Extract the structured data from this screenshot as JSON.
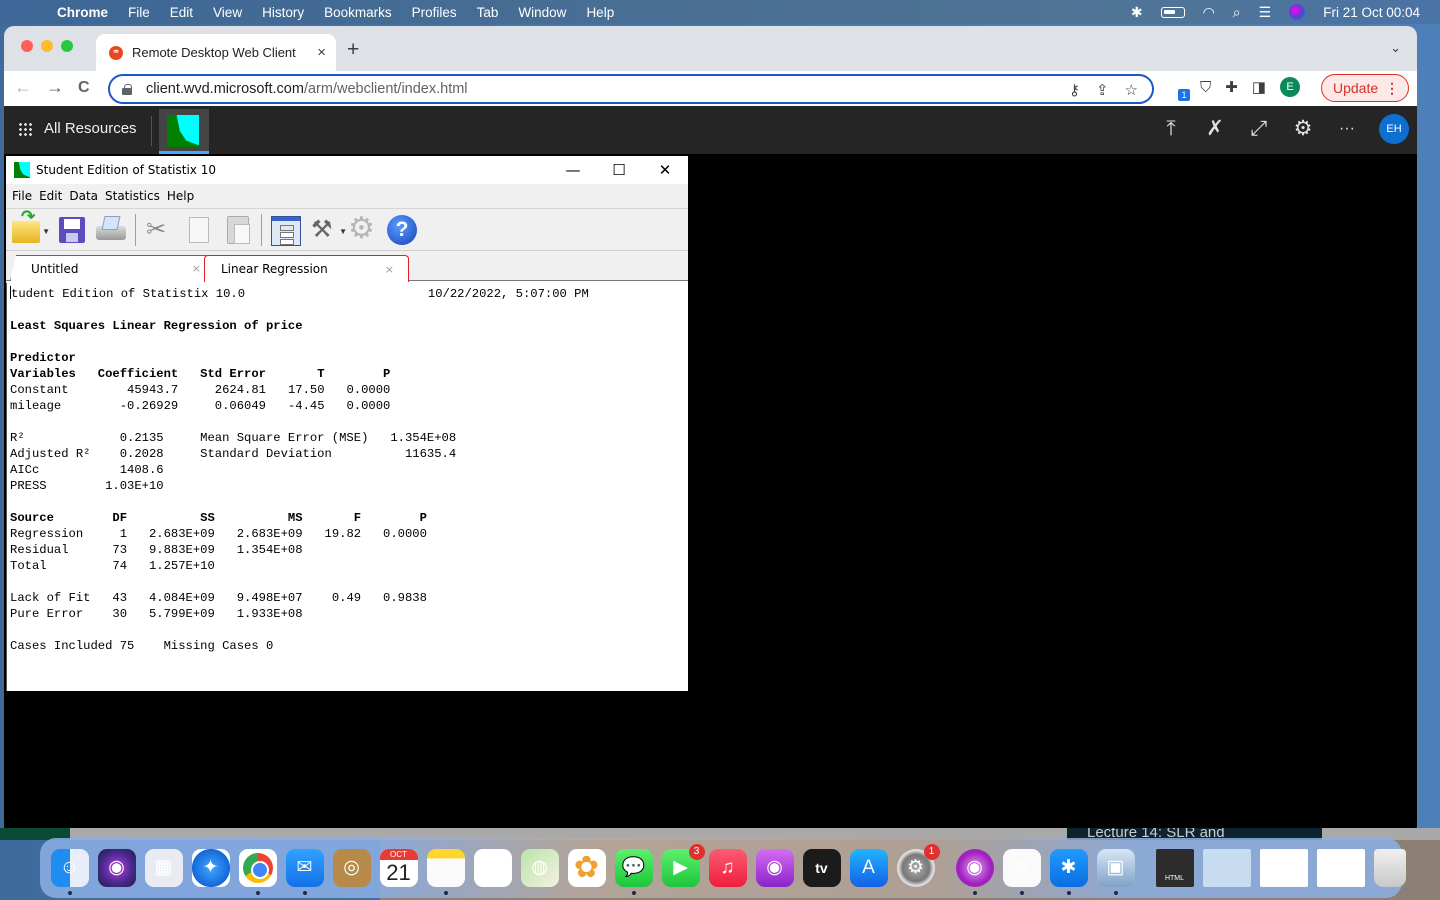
{
  "menubar": {
    "apple_icon": "apple-logo-icon",
    "app_name": "Chrome",
    "items": [
      "File",
      "Edit",
      "View",
      "History",
      "Bookmarks",
      "Profiles",
      "Tab",
      "Window",
      "Help"
    ],
    "status_icons": [
      "bluetooth-icon",
      "battery-icon",
      "wifi-icon",
      "spotlight-search-icon",
      "control-center-icon",
      "siri-icon"
    ],
    "clock": "Fri 21 Oct  00:04"
  },
  "browser": {
    "tab": {
      "title": "Remote Desktop Web Client",
      "close": "×"
    },
    "new_tab": "+",
    "tab_search": "⌄",
    "nav": {
      "back": "←",
      "forward": "→",
      "reload": "C"
    },
    "url": {
      "host": "client.wvd.microsoft.com",
      "path": "/arm/webclient/index.html"
    },
    "omni_icons": {
      "key": "⚷",
      "share": "⇪",
      "star": "☆"
    },
    "extensions": {
      "badge_count": "1",
      "shield": "⛉",
      "puzzle": "✚",
      "sidepanel": "◨",
      "profile_initial": "E"
    },
    "update_label": "Update",
    "update_menu": "⋮"
  },
  "rdclient": {
    "all_resources": "All Resources",
    "right_icons": {
      "upload": "⤒",
      "pin": "✗",
      "fullscreen": "⤢",
      "settings": "⚙",
      "more": "···"
    },
    "user_initials": "EH"
  },
  "statistix": {
    "title": "Student Edition of Statistix 10",
    "window_buttons": {
      "minimize": "—",
      "maximize": "☐",
      "close": "✕"
    },
    "menu": [
      "File",
      "Edit",
      "Data",
      "Statistics",
      "Help"
    ],
    "toolbar": [
      "open",
      "save",
      "print",
      "cut",
      "copy",
      "paste",
      "dialog",
      "dig",
      "options",
      "help"
    ],
    "tabs": [
      {
        "label": "Untitled",
        "close": "×",
        "active": false
      },
      {
        "label": "Linear Regression",
        "close": "×",
        "active": true
      }
    ],
    "report": {
      "header_left": "Student Edition of Statistix 10.0",
      "header_right": "10/22/2022, 5:07:00 PM",
      "title": "Least Squares Linear Regression of price",
      "coef_header1": "Predictor",
      "coef_columns": [
        "Variables",
        "Coefficient",
        "Std Error",
        "T",
        "P"
      ],
      "coef_rows": [
        [
          "Constant",
          "45943.7",
          "2624.81",
          "17.50",
          "0.0000"
        ],
        [
          "mileage",
          "-0.26929",
          "0.06049",
          "-4.45",
          "0.0000"
        ]
      ],
      "fit_stats": [
        {
          "label": "R²",
          "value": "0.2135",
          "label2": "Mean Square Error (MSE)",
          "value2": "1.354E+08"
        },
        {
          "label": "Adjusted R²",
          "value": "0.2028",
          "label2": "Standard Deviation",
          "value2": "11635.4"
        },
        {
          "label": "AICc",
          "value": "1408.6",
          "label2": "",
          "value2": ""
        },
        {
          "label": "PRESS",
          "value": "1.03E+10",
          "label2": "",
          "value2": ""
        }
      ],
      "anova_columns": [
        "Source",
        "DF",
        "SS",
        "MS",
        "F",
        "P"
      ],
      "anova_rows": [
        [
          "Regression",
          "1",
          "2.683E+09",
          "2.683E+09",
          "19.82",
          "0.0000"
        ],
        [
          "Residual",
          "73",
          "9.883E+09",
          "1.354E+08",
          "",
          ""
        ],
        [
          "Total",
          "74",
          "1.257E+10",
          "",
          "",
          ""
        ]
      ],
      "lof_rows": [
        [
          "Lack of Fit",
          "43",
          "4.084E+09",
          "9.498E+07",
          "0.49",
          "0.9838"
        ],
        [
          "Pure Error",
          "30",
          "5.799E+09",
          "1.933E+08",
          "",
          ""
        ]
      ],
      "cases_included": "Cases Included 75",
      "missing_cases": "Missing Cases 0"
    }
  },
  "background_window_text": "Lecture 14: SLR and",
  "dock": {
    "apps": [
      {
        "name": "Finder",
        "running": true
      },
      {
        "name": "Siri",
        "running": false
      },
      {
        "name": "Launchpad",
        "running": false
      },
      {
        "name": "Safari",
        "running": false
      },
      {
        "name": "Chrome",
        "running": true
      },
      {
        "name": "Mail",
        "running": true
      },
      {
        "name": "Contacts",
        "running": false
      },
      {
        "name": "Calendar",
        "running": false,
        "month": "OCT",
        "day": "21"
      },
      {
        "name": "Notes",
        "running": true
      },
      {
        "name": "Reminders",
        "running": false
      },
      {
        "name": "Maps",
        "running": false
      },
      {
        "name": "Photos",
        "running": false
      },
      {
        "name": "Messages",
        "running": true
      },
      {
        "name": "FaceTime",
        "running": false,
        "badge": "3"
      },
      {
        "name": "Music",
        "running": false
      },
      {
        "name": "Podcasts",
        "running": false
      },
      {
        "name": "TV",
        "running": false,
        "label": "tv"
      },
      {
        "name": "App Store",
        "running": false
      },
      {
        "name": "System Preferences",
        "running": false,
        "badge": "1"
      },
      {
        "name": "Screen Recorder",
        "running": true
      },
      {
        "name": "TextEdit",
        "running": true
      },
      {
        "name": "Bluetooth File Exchange",
        "running": true
      },
      {
        "name": "Preview",
        "running": true
      }
    ],
    "files_label": "HTML"
  }
}
